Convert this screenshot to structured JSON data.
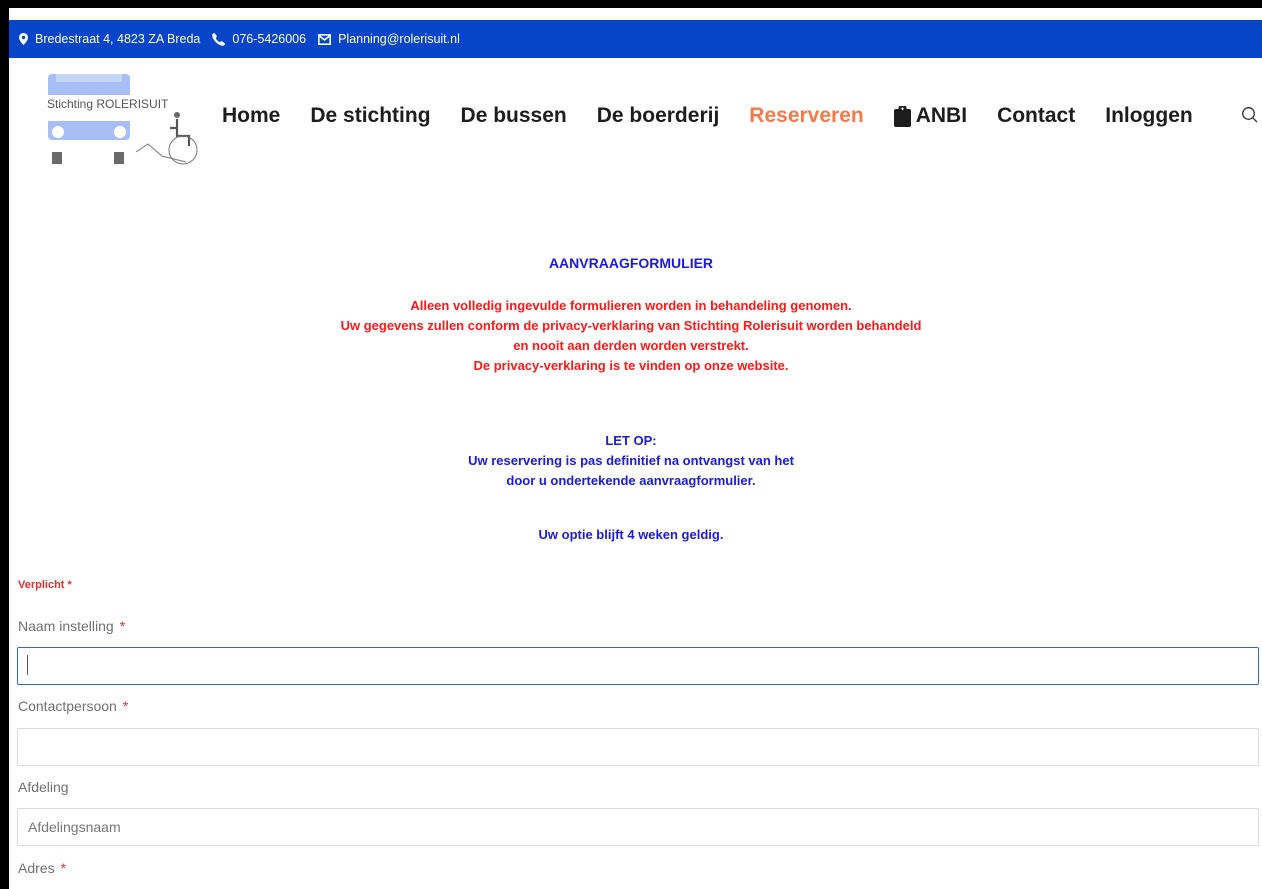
{
  "topbar": {
    "address": "Bredestraat 4, 4823 ZA Breda",
    "phone": "076-5426006",
    "email": "Planning@rolerisuit.nl",
    "background": "#0645c9"
  },
  "logo": {
    "text": "Stichting ROLERISUIT"
  },
  "nav": {
    "items": [
      "Home",
      "De stichting",
      "De bussen",
      "De boerderij",
      "Reserveren",
      "ANBI",
      "Contact",
      "Inloggen"
    ],
    "active": "Reserveren",
    "active_color": "#f47a4c",
    "anbi_icon": "clipboard-icon",
    "search_icon": "search-icon"
  },
  "content": {
    "heading": "AANVRAAGFORMULIER",
    "red_lines": [
      "Alleen volledig ingevulde formulieren worden in behandeling genomen.",
      "Uw gegevens zullen conform de privacy-verklaring van Stichting Rolerisuit worden behandeld",
      "en nooit aan derden worden verstrekt.",
      "De privacy-verklaring is te vinden op onze website."
    ],
    "blue_lines": [
      "LET OP:",
      "Uw reservering is pas definitief na ontvangst van het",
      "door u ondertekende aanvraagformulier."
    ],
    "optie": "Uw optie blijft 4 weken geldig.",
    "heading_color": "#1a1ae0",
    "warning_color": "#ff1a1a"
  },
  "form": {
    "required_note": "Verplicht",
    "required_star": "*",
    "fields": [
      {
        "label": "Naam instelling",
        "required": true,
        "value": "",
        "placeholder": ""
      },
      {
        "label": "Contactpersoon",
        "required": true,
        "value": "",
        "placeholder": ""
      },
      {
        "label": "Afdeling",
        "required": false,
        "value": "",
        "placeholder": "Afdelingsnaam"
      },
      {
        "label": "Adres",
        "required": true
      }
    ]
  }
}
